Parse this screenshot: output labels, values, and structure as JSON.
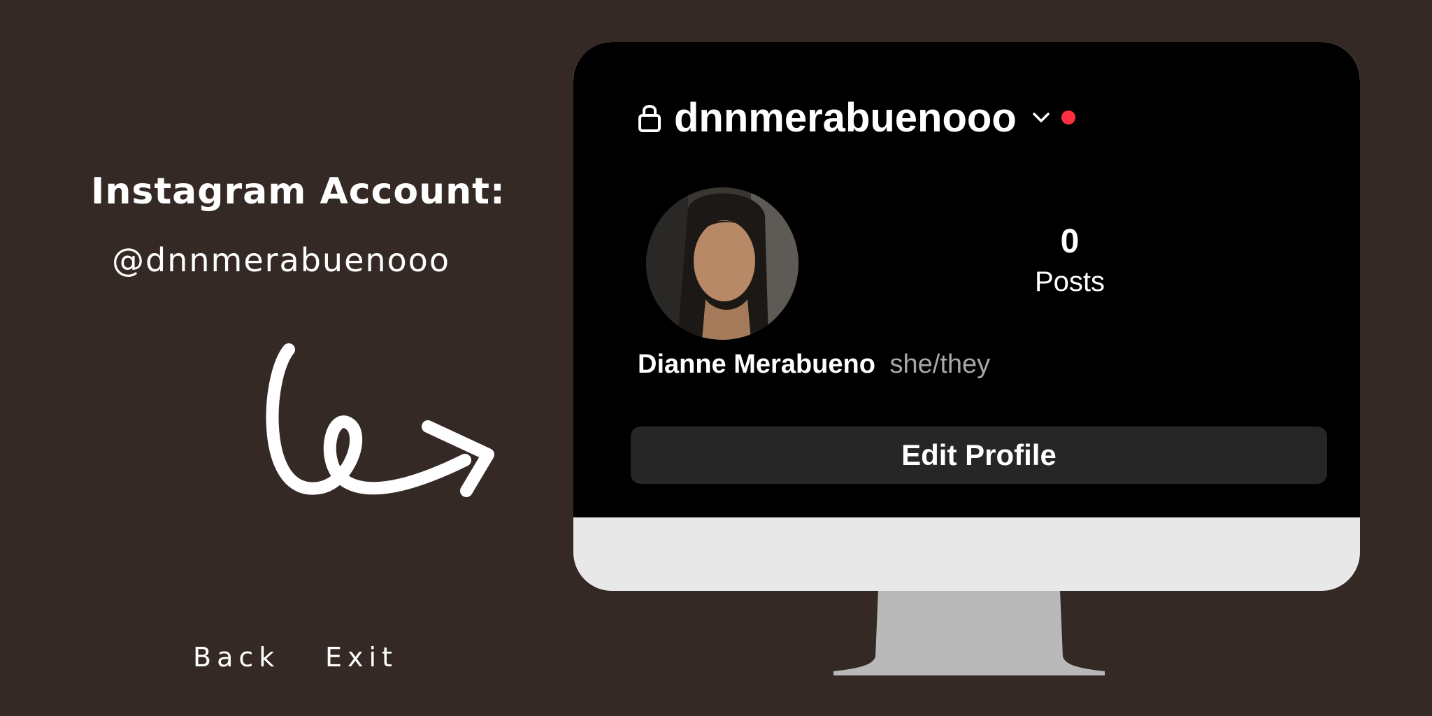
{
  "left_panel": {
    "heading": "Instagram Account:",
    "handle": "@dnnmerabuenooo",
    "nav": {
      "back": "Back",
      "exit": "Exit"
    }
  },
  "profile": {
    "username": "dnnmerabuenooo",
    "posts_count": "0",
    "posts_label": "Posts",
    "display_name": "Dianne Merabueno",
    "pronouns": "she/they",
    "edit_button": "Edit Profile",
    "notification_dot_color": "#ff3040"
  },
  "icons": [
    "lock-icon",
    "chevron-down-icon",
    "curly-arrow-icon"
  ]
}
